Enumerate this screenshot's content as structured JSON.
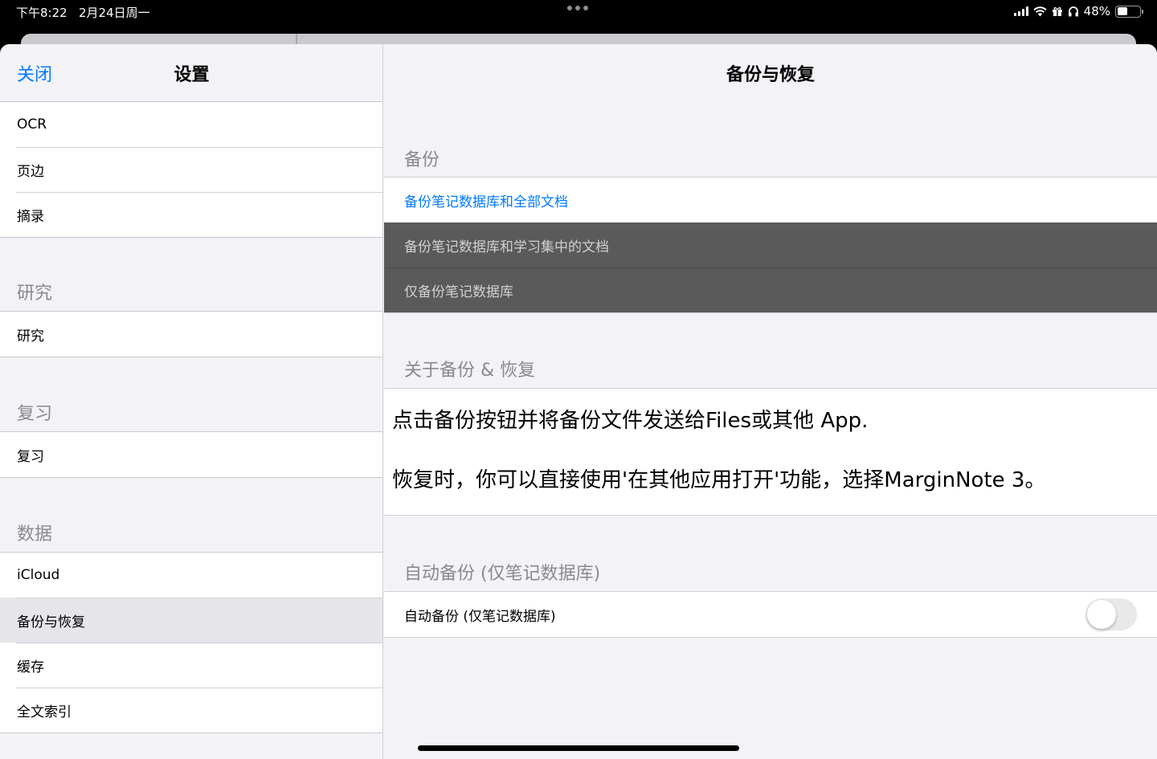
{
  "status": {
    "time": "下午8:22",
    "date": "2月24日周一",
    "battery": "48%",
    "battery_level": 0.48
  },
  "master": {
    "close_label": "关闭",
    "title": "设置",
    "top_items": [
      "OCR",
      "页边",
      "摘录"
    ],
    "sections": [
      {
        "header": "研究",
        "items": [
          "研究"
        ]
      },
      {
        "header": "复习",
        "items": [
          "复习"
        ]
      },
      {
        "header": "数据",
        "items": [
          "iCloud",
          "备份与恢复",
          "缓存",
          "全文索引"
        ]
      }
    ]
  },
  "detail": {
    "title": "备份与恢复",
    "backup_header": "备份",
    "backup_all": "备份笔记数据库和全部文档",
    "backup_studyset": "备份笔记数据库和学习集中的文档",
    "backup_db_only": "仅备份笔记数据库",
    "about_header": "关于备份 & 恢复",
    "about_line1": "点击备份按钮并将备份文件发送给Files或其他 App.",
    "about_line2": "恢复时，你可以直接使用'在其他应用打开'功能，选择MarginNote 3。",
    "auto_header": "自动备份 (仅笔记数据库)",
    "auto_label": "自动备份 (仅笔记数据库)",
    "auto_enabled": false
  }
}
